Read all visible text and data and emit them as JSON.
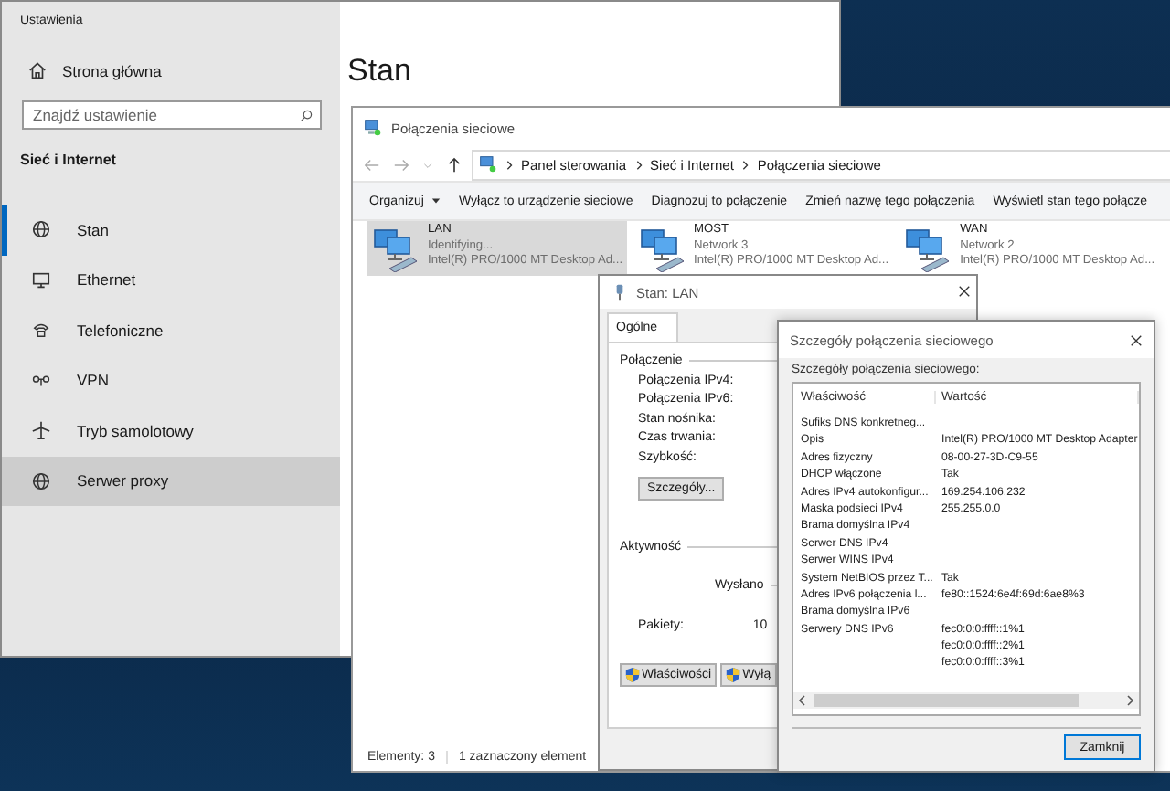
{
  "settings": {
    "title": "Ustawienia",
    "home": "Strona główna",
    "search": {
      "placeholder": "Znajdź ustawienie"
    },
    "section": "Sieć i Internet",
    "heading": "Stan",
    "nav": [
      {
        "label": "Stan",
        "selected": true,
        "hovered": false
      },
      {
        "label": "Ethernet",
        "selected": false,
        "hovered": false
      },
      {
        "label": "Telefoniczne",
        "selected": false,
        "hovered": false
      },
      {
        "label": "VPN",
        "selected": false,
        "hovered": false
      },
      {
        "label": "Tryb samolotowy",
        "selected": false,
        "hovered": false
      },
      {
        "label": "Serwer proxy",
        "selected": false,
        "hovered": true
      }
    ]
  },
  "network_window": {
    "title": "Połączenia sieciowe",
    "breadcrumb": [
      "Panel sterowania",
      "Sieć i Internet",
      "Połączenia sieciowe"
    ],
    "toolbar": [
      {
        "label": "Organizuj",
        "dropdown": true
      },
      {
        "label": "Wyłącz to urządzenie sieciowe",
        "dropdown": false
      },
      {
        "label": "Diagnozuj to połączenie",
        "dropdown": false
      },
      {
        "label": "Zmień nazwę tego połączenia",
        "dropdown": false
      },
      {
        "label": "Wyświetl stan tego połącze",
        "dropdown": false
      }
    ],
    "connections": [
      {
        "name": "LAN",
        "status": "Identifying...",
        "adapter": "Intel(R) PRO/1000 MT Desktop Ad...",
        "selected": true
      },
      {
        "name": "MOST",
        "status": "Network 3",
        "adapter": "Intel(R) PRO/1000 MT Desktop Ad...",
        "selected": false
      },
      {
        "name": "WAN",
        "status": "Network 2",
        "adapter": "Intel(R) PRO/1000 MT Desktop Ad...",
        "selected": false
      }
    ],
    "status_bar": [
      "Elementy: 3",
      "1 zaznaczony element"
    ]
  },
  "status_dialog": {
    "title": "Stan: LAN",
    "tabs": [
      {
        "label": "Ogólne",
        "selected": true
      }
    ],
    "connection_group": {
      "title": "Połączenie",
      "fields": [
        "Połączenia IPv4:",
        "Połączenia IPv6:",
        "Stan nośnika:",
        "Czas trwania:",
        "Szybkość:"
      ]
    },
    "details_button": "Szczegóły...",
    "activity_group": {
      "title": "Aktywność",
      "sent_label": "Wysłano",
      "packets_label": "Pakiety:",
      "packets_sent": "10"
    },
    "buttons": [
      "Właściwości",
      "Wyłą"
    ]
  },
  "details_dialog": {
    "title": "Szczegóły połączenia sieciowego",
    "label": "Szczegóły połączenia sieciowego:",
    "columns": [
      "Właściwość",
      "Wartość"
    ],
    "rows": [
      {
        "property": "Sufiks DNS konkretneg..."
      },
      {
        "property": "Opis",
        "value": "Intel(R) PRO/1000 MT Desktop Adapter"
      },
      {
        "property": "Adres fizyczny",
        "value": "08-00-27-3D-C9-55"
      },
      {
        "property": "DHCP włączone",
        "value": "Tak"
      },
      {
        "property": "Adres IPv4 autokonfigur...",
        "value": "169.254.106.232"
      },
      {
        "property": "Maska podsieci IPv4",
        "value": "255.255.0.0"
      },
      {
        "property": "Brama domyślna IPv4"
      },
      {
        "property": "Serwer DNS IPv4"
      },
      {
        "property": "Serwer WINS IPv4"
      },
      {
        "property": "System NetBIOS przez T...",
        "value": "Tak"
      },
      {
        "property": "Adres IPv6 połączenia l...",
        "value": "fe80::1524:6e4f:69d:6ae8%3"
      },
      {
        "property": "Brama domyślna IPv6"
      },
      {
        "property": "Serwery DNS IPv6",
        "value": "fec0:0:0:ffff::1%1"
      },
      {
        "value": "fec0:0:0:ffff::2%1"
      },
      {
        "value": "fec0:0:0:ffff::3%1"
      }
    ],
    "button": "Zamknij"
  }
}
